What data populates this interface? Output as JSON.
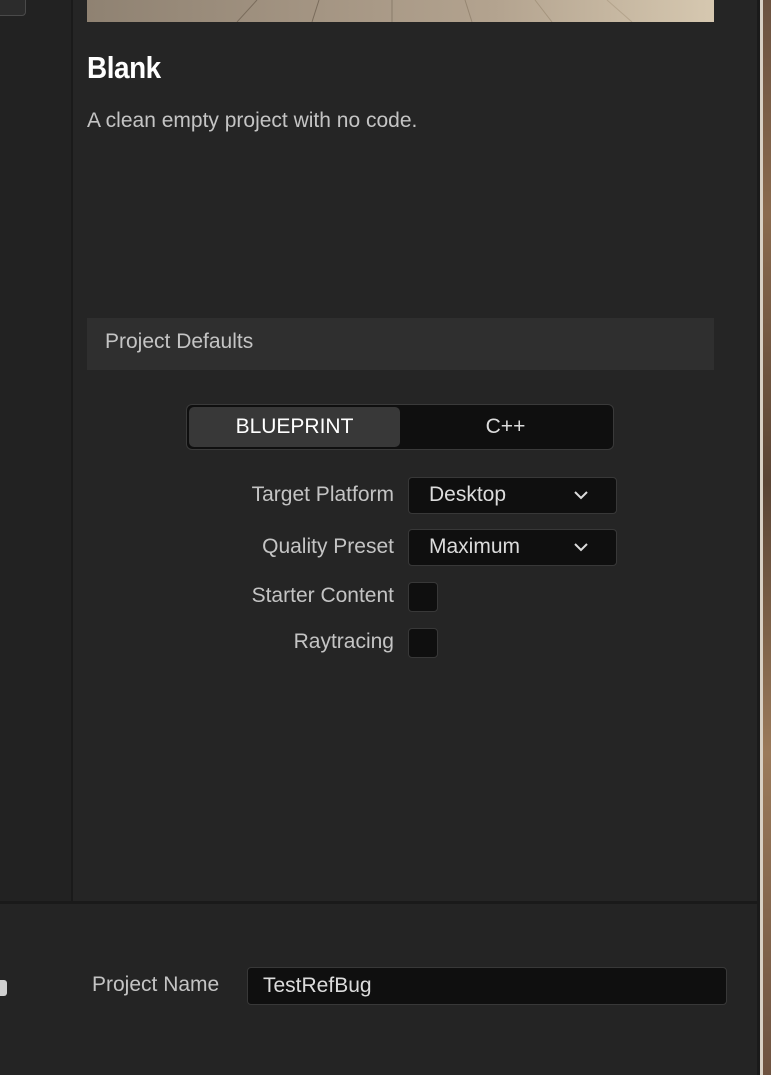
{
  "template": {
    "title": "Blank",
    "description": "A clean empty project with no code."
  },
  "project_defaults": {
    "section_title": "Project Defaults",
    "language_options": [
      "BLUEPRINT",
      "C++"
    ],
    "selected_language": "BLUEPRINT",
    "target_platform": {
      "label": "Target Platform",
      "value": "Desktop",
      "icon": "chevron-down-icon"
    },
    "quality_preset": {
      "label": "Quality Preset",
      "value": "Maximum",
      "icon": "chevron-down-icon"
    },
    "starter_content": {
      "label": "Starter Content",
      "checked": false
    },
    "raytracing": {
      "label": "Raytracing",
      "checked": false
    }
  },
  "project_name": {
    "label": "Project Name",
    "value": "TestRefBug"
  },
  "colors": {
    "panel_bg": "#252525",
    "field_bg": "#0f0f0f",
    "section_header_bg": "#2f2f2f",
    "active_toggle_bg": "#383838",
    "text": "#c4c4c4",
    "title_text": "#ffffff"
  }
}
